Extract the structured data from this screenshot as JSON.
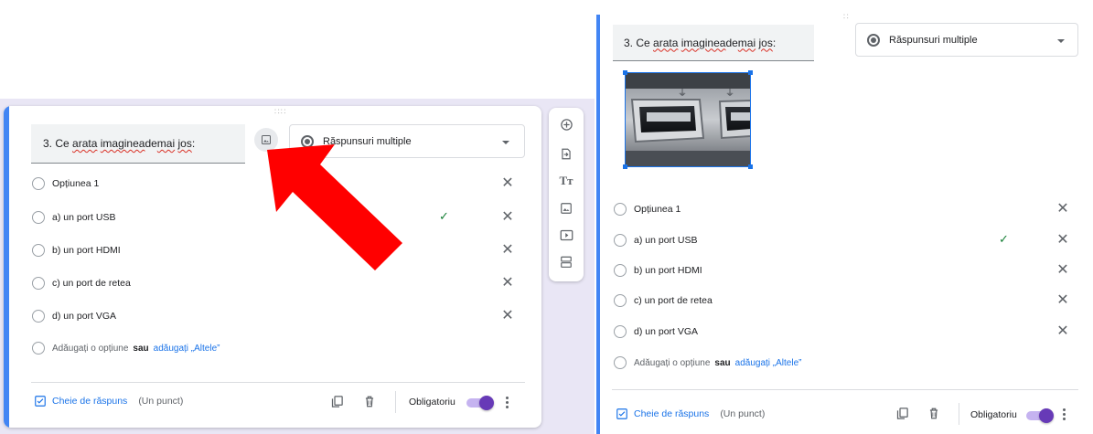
{
  "left": {
    "question_text_prefix": "3. Ce ",
    "question_word1": "arata",
    "question_word2": "imaginea",
    "question_mid": " de ",
    "question_word3": "mai",
    "question_word4": "jos",
    "question_suffix": ":",
    "question_type": "Răspunsuri multiple",
    "options": [
      {
        "label": "Opțiunea 1",
        "correct": false
      },
      {
        "label": "a) un port USB",
        "correct": true
      },
      {
        "label": "b) un port HDMI",
        "correct": false
      },
      {
        "label": "c) un port de retea",
        "correct": false
      },
      {
        "label": "d) un port VGA",
        "correct": false
      }
    ],
    "add_option": "Adăugați o opțiune",
    "or_word": "sau",
    "add_other": "adăugați „Altele”",
    "answer_key": "Cheie de răspuns",
    "points": "(Un punct)",
    "required_label": "Obligatoriu",
    "required_on": true
  },
  "right": {
    "question_text_prefix": "3. Ce ",
    "question_word1": "arata",
    "question_word2": "imaginea",
    "question_mid": " de ",
    "question_word3": "mai",
    "question_word4": "jos",
    "question_suffix": ":",
    "question_type": "Răspunsuri multiple",
    "options": [
      {
        "label": "Opțiunea 1",
        "correct": false
      },
      {
        "label": "a) un port USB",
        "correct": true
      },
      {
        "label": "b) un port HDMI",
        "correct": false
      },
      {
        "label": "c) un port de retea",
        "correct": false
      },
      {
        "label": "d) un port VGA",
        "correct": false
      }
    ],
    "add_option": "Adăugați o opțiune",
    "or_word": "sau",
    "add_other": "adăugați „Altele”",
    "answer_key": "Cheie de răspuns",
    "points": "(Un punct)",
    "required_label": "Obligatoriu",
    "required_on": true
  },
  "toolbar_icons": [
    "add-question-icon",
    "import-questions-icon",
    "add-title-icon",
    "add-image-icon",
    "add-video-icon",
    "add-section-icon"
  ],
  "icons": {
    "image": "image-icon",
    "radio": "radio-button-icon",
    "dropdown": "chevron-down-icon",
    "remove": "close-icon",
    "correct": "checkmark-icon",
    "answer_key": "answer-key-icon",
    "duplicate": "duplicate-icon",
    "delete": "trash-icon",
    "more": "more-vert-icon",
    "drag": "drag-handle-icon"
  },
  "annotation": {
    "arrow": "red-arrow",
    "color": "#ff0000"
  },
  "colors": {
    "accent": "#4285f4",
    "toggle": "#673ab7",
    "link": "#1a73e8",
    "check": "#188038",
    "left_bg": "#e9e6f5"
  }
}
